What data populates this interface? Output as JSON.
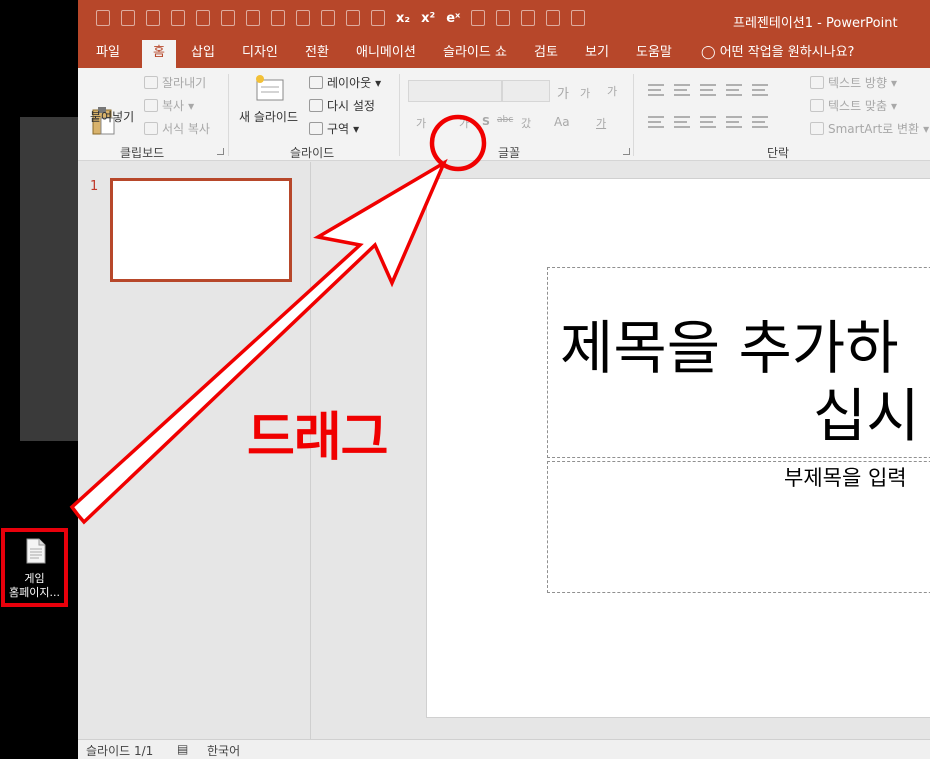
{
  "desktop": {
    "icon_label_line1": "게임",
    "icon_label_line2": "홈페이지..."
  },
  "window": {
    "title": "프레젠테이션1  -  PowerPoint",
    "qat_subscript": "x₂",
    "qat_superscript": "x²",
    "qat_equation": "eˣ"
  },
  "tabs": [
    {
      "label": "파일"
    },
    {
      "label": "홈"
    },
    {
      "label": "삽입"
    },
    {
      "label": "디자인"
    },
    {
      "label": "전환"
    },
    {
      "label": "애니메이션"
    },
    {
      "label": "슬라이드 쇼"
    },
    {
      "label": "검토"
    },
    {
      "label": "보기"
    },
    {
      "label": "도움말"
    }
  ],
  "tell_me": "어떤 작업을 원하시나요?",
  "ribbon": {
    "clipboard": {
      "paste": "붙여넣기",
      "cut": "잘라내기",
      "copy": "복사",
      "format_painter": "서식 복사",
      "group_label": "클립보드"
    },
    "slides": {
      "new_slide": "새 슬라이드",
      "layout": "레이아웃",
      "reset": "다시 설정",
      "section": "구역",
      "group_label": "슬라이드"
    },
    "font": {
      "group_label": "글꼴",
      "grow": "가",
      "shrink": "가",
      "clear": "가",
      "bold": "가",
      "shadow": "S",
      "strike": "abc",
      "spacing": "갔",
      "case": "Aa",
      "color": "가"
    },
    "paragraph": {
      "text_direction": "텍스트 방향",
      "align_text": "텍스트 맞춤",
      "smartart": "SmartArt로 변환",
      "group_label": "단락"
    }
  },
  "slides_pane": {
    "slide_number": "1"
  },
  "slide": {
    "title_line1": "제목을 추가하",
    "title_line2": "십시",
    "subtitle": "부제목을 입력"
  },
  "status_bar": {
    "slide_info": "슬라이드 1/1",
    "language": "한국어"
  },
  "annotation": {
    "label": "드래그",
    "color": "#f00000"
  },
  "colors": {
    "accent": "#b7472a",
    "annotation_red": "#e8000b"
  }
}
